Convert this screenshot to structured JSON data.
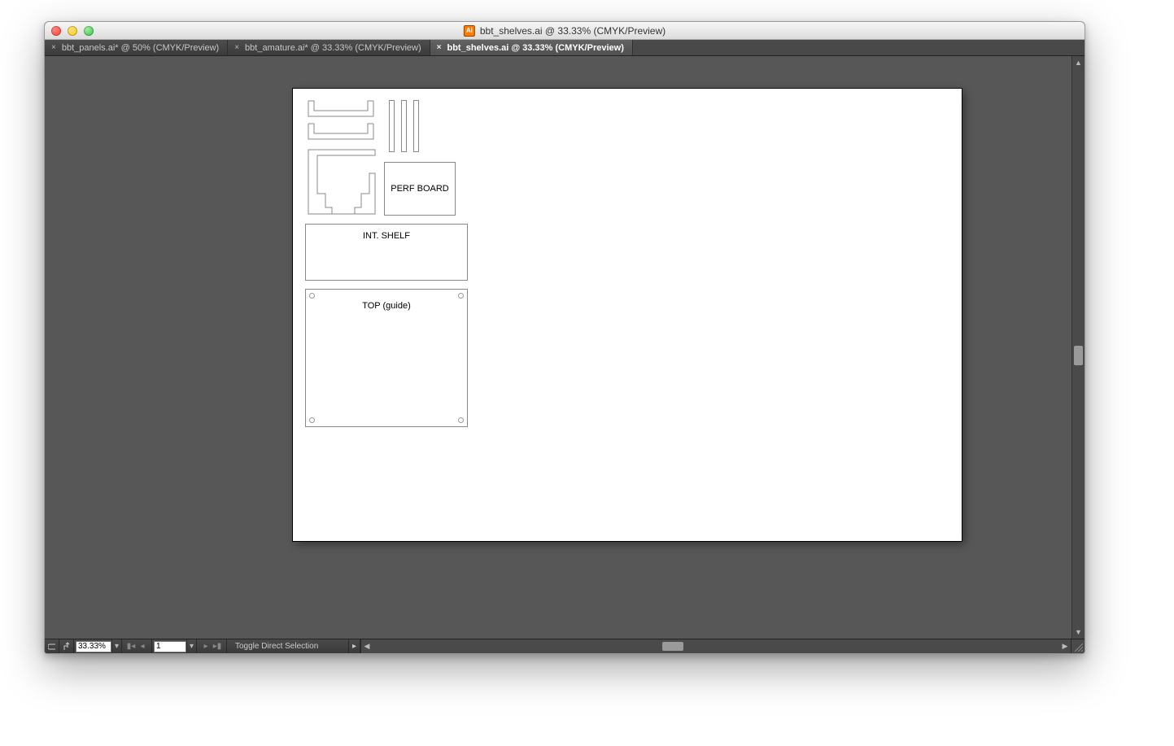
{
  "window": {
    "title": "bbt_shelves.ai @ 33.33% (CMYK/Preview)"
  },
  "tabs": [
    {
      "label": "bbt_panels.ai* @ 50% (CMYK/Preview)",
      "active": false
    },
    {
      "label": "bbt_amature.ai* @ 33.33% (CMYK/Preview)",
      "active": false
    },
    {
      "label": "bbt_shelves.ai @ 33.33% (CMYK/Preview)",
      "active": true
    }
  ],
  "artboard": {
    "labels": {
      "perf_board": "PERF BOARD",
      "int_shelf": "INT. SHELF",
      "top_guide": "TOP (guide)"
    }
  },
  "status": {
    "zoom": "33.33%",
    "page": "1",
    "tool_hint": "Toggle Direct Selection"
  }
}
